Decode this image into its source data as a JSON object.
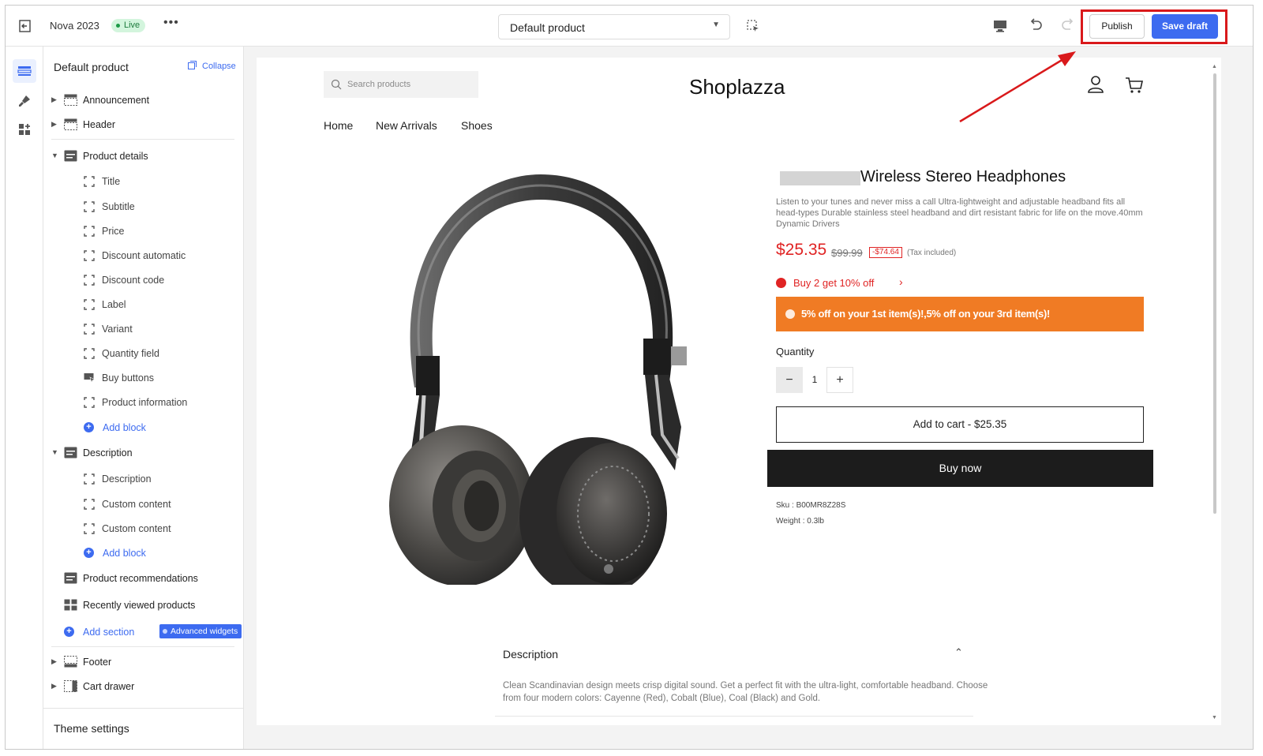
{
  "topbar": {
    "theme_name": "Nova 2023",
    "live_badge": "Live",
    "more": "•••",
    "template_select": "Default product",
    "publish_label": "Publish",
    "save_draft_label": "Save draft"
  },
  "sidebar": {
    "title": "Default product",
    "collapse_label": "Collapse",
    "sections": [
      {
        "label": "Announcement"
      },
      {
        "label": "Header"
      },
      {
        "label": "Product details"
      },
      {
        "label": "Description"
      },
      {
        "label": "Product recommendations"
      },
      {
        "label": "Recently viewed products"
      },
      {
        "label": "Footer"
      },
      {
        "label": "Cart drawer"
      }
    ],
    "product_blocks": [
      "Title",
      "Subtitle",
      "Price",
      "Discount automatic",
      "Discount code",
      "Label",
      "Variant",
      "Quantity field",
      "Buy buttons",
      "Product information"
    ],
    "description_blocks": [
      "Description",
      "Custom content",
      "Custom content"
    ],
    "add_block_label": "Add block",
    "add_section_label": "Add section",
    "advanced_widgets_label": "Advanced widgets",
    "theme_settings_label": "Theme settings"
  },
  "store": {
    "search_placeholder": "Search products",
    "logo": "Shoplazza",
    "nav": [
      "Home",
      "New Arrivals",
      "Shoes"
    ]
  },
  "product": {
    "title": "Wireless Stereo Headphones",
    "description": "Listen to your tunes and never miss a call Ultra-lightweight and adjustable headband fits all head-types Durable stainless steel headband and dirt resistant fabric for life on the move.40mm Dynamic Drivers",
    "price": "$25.35",
    "compare_price": "$99.99",
    "saving": "-$74.64",
    "tax_note": "(Tax included)",
    "promo": "Buy 2 get 10% off",
    "discount_banner": "5% off on your 1st item(s)!,5% off on your 3rd item(s)!",
    "quantity_label": "Quantity",
    "quantity": "1",
    "add_to_cart": "Add to cart  -  $25.35",
    "buy_now": "Buy now",
    "sku": "Sku : B00MR8Z28S",
    "weight": "Weight : 0.3lb"
  },
  "description_section": {
    "heading": "Description",
    "text": "Clean Scandinavian design meets crisp digital sound. Get a perfect fit with the ultra-light, comfortable headband. Choose from four modern colors: Cayenne (Red), Cobalt (Blue), Coal (Black) and Gold."
  },
  "colors": {
    "accent": "#3d6bf0",
    "highlight": "#d9191b",
    "price": "#e02424",
    "banner": "#f07b24"
  }
}
